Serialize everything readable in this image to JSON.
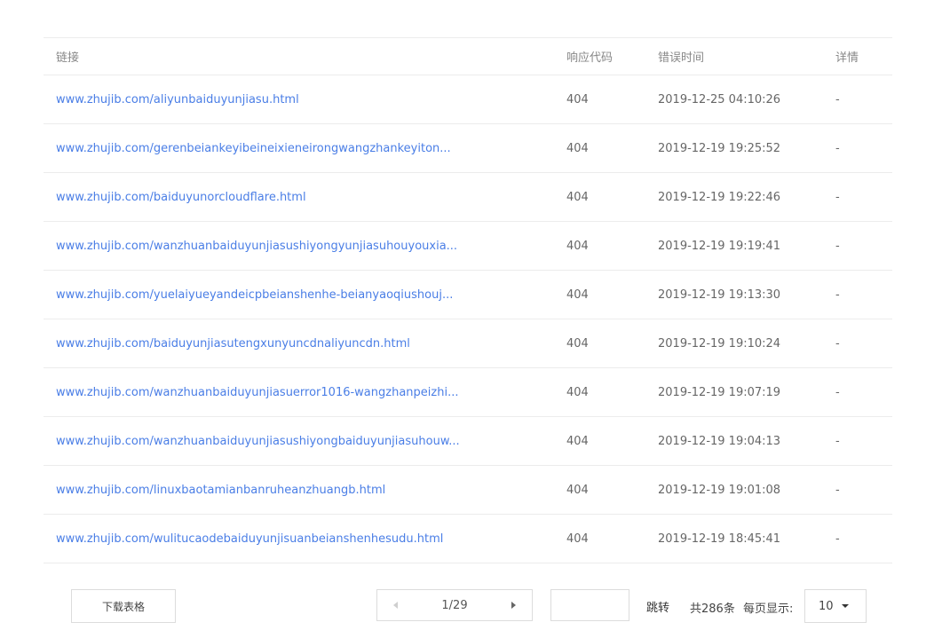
{
  "table": {
    "headers": {
      "link": "链接",
      "code": "响应代码",
      "time": "错误时间",
      "detail": "详情"
    },
    "rows": [
      {
        "link": "www.zhujib.com/aliyunbaiduyunjiasu.html",
        "code": "404",
        "time": "2019-12-25 04:10:26",
        "detail": "-"
      },
      {
        "link": "www.zhujib.com/gerenbeiankeyibeineixieneirongwangzhankeyiton...",
        "code": "404",
        "time": "2019-12-19 19:25:52",
        "detail": "-"
      },
      {
        "link": "www.zhujib.com/baiduyunorcloudflare.html",
        "code": "404",
        "time": "2019-12-19 19:22:46",
        "detail": "-"
      },
      {
        "link": "www.zhujib.com/wanzhuanbaiduyunjiasushiyongyunjiasuhouyouxia...",
        "code": "404",
        "time": "2019-12-19 19:19:41",
        "detail": "-"
      },
      {
        "link": "www.zhujib.com/yuelaiyueyandeicpbeianshenhe-beianyaoqiushouj...",
        "code": "404",
        "time": "2019-12-19 19:13:30",
        "detail": "-"
      },
      {
        "link": "www.zhujib.com/baiduyunjiasutengxunyuncdnaliyuncdn.html",
        "code": "404",
        "time": "2019-12-19 19:10:24",
        "detail": "-"
      },
      {
        "link": "www.zhujib.com/wanzhuanbaiduyunjiasuerror1016-wangzhanpeizhi...",
        "code": "404",
        "time": "2019-12-19 19:07:19",
        "detail": "-"
      },
      {
        "link": "www.zhujib.com/wanzhuanbaiduyunjiasushiyongbaiduyunjiasuhouw...",
        "code": "404",
        "time": "2019-12-19 19:04:13",
        "detail": "-"
      },
      {
        "link": "www.zhujib.com/linuxbaotamianbanruheanzhuangb.html",
        "code": "404",
        "time": "2019-12-19 19:01:08",
        "detail": "-"
      },
      {
        "link": "www.zhujib.com/wulitucaodebaiduyunjisuanbeianshenhesudu.html",
        "code": "404",
        "time": "2019-12-19 18:45:41",
        "detail": "-"
      }
    ]
  },
  "footer": {
    "download_label": "下载表格",
    "pager_text": "1/29",
    "page_input_value": "",
    "jump_label": "跳转",
    "total_text": "共286条",
    "per_page_label": "每页显示:",
    "per_page_value": "10"
  },
  "colors": {
    "link": "#4a7ee6",
    "border": "#ececec"
  },
  "icons": {
    "prev": "triangle-left-icon",
    "next": "triangle-right-icon",
    "dropdown": "caret-down-icon"
  }
}
